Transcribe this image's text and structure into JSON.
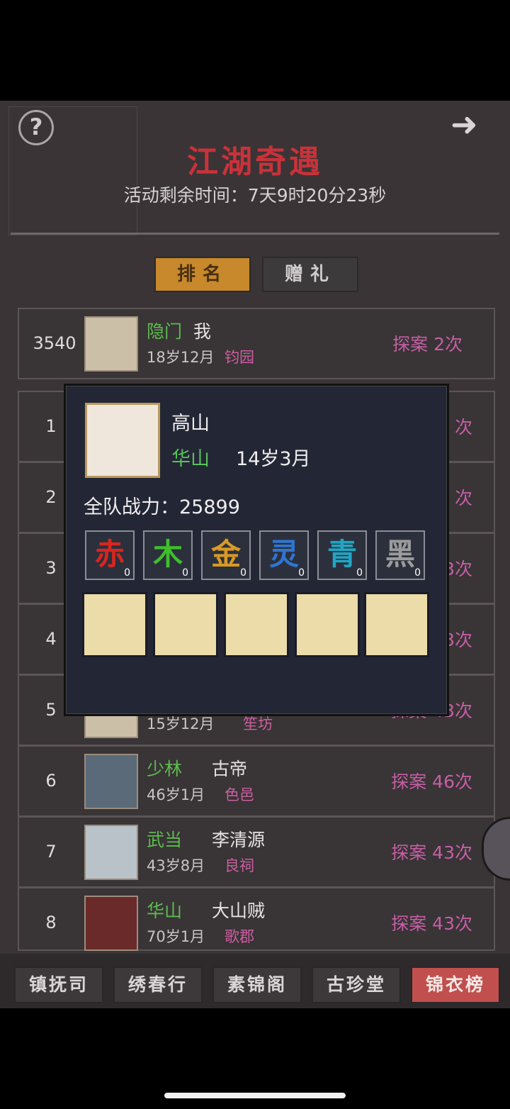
{
  "header": {
    "title": "江湖奇遇",
    "timer": "活动剩余时间：7天9时20分23秒"
  },
  "tabs": {
    "rank": "排名",
    "gift": "赠礼"
  },
  "me": {
    "rank": "3540",
    "sect": "隐门",
    "name": "我",
    "age": "18岁12月",
    "place": "钧园",
    "score": "探案 2次"
  },
  "rows": [
    {
      "rank": "1",
      "score": "次"
    },
    {
      "rank": "2",
      "score": "次"
    },
    {
      "rank": "3",
      "score": "3次"
    },
    {
      "rank": "4",
      "score": "3次"
    },
    {
      "rank": "5",
      "age": "15岁12月",
      "place": "笙坊",
      "score": "探案 43次"
    },
    {
      "rank": "6",
      "sect": "少林",
      "name": "古帝",
      "age": "46岁1月",
      "place": "色邑",
      "score": "探案 46次"
    },
    {
      "rank": "7",
      "sect": "武当",
      "name": "李清源",
      "age": "43岁8月",
      "place": "良祠",
      "score": "探案 43次"
    },
    {
      "rank": "8",
      "sect": "华山",
      "name": "大山贼",
      "age": "70岁1月",
      "place": "歌郡",
      "score": "探案 43次"
    }
  ],
  "popup": {
    "name": "高山",
    "sect": "华山",
    "age": "14岁3月",
    "power": "全队战力：25899",
    "elements": [
      {
        "glyph": "赤",
        "count": "0",
        "color": "#d8261f"
      },
      {
        "glyph": "木",
        "count": "0",
        "color": "#3ec02a"
      },
      {
        "glyph": "金",
        "count": "0",
        "color": "#d79a25"
      },
      {
        "glyph": "灵",
        "count": "0",
        "color": "#2e76d3"
      },
      {
        "glyph": "青",
        "count": "0",
        "color": "#21a6c4"
      },
      {
        "glyph": "黑",
        "count": "0",
        "color": "#9b9b9b"
      }
    ]
  },
  "bottom": [
    "镇抚司",
    "绣春行",
    "素锦阁",
    "古珍堂",
    "锦衣榜"
  ]
}
